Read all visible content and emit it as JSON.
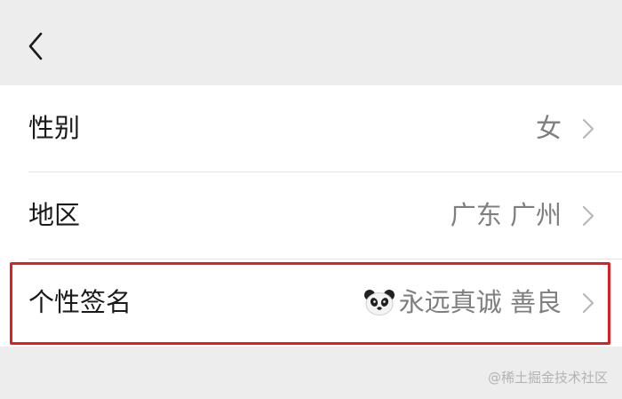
{
  "header": {
    "back_icon": "chevron-left-icon"
  },
  "rows": [
    {
      "label": "性别",
      "value": "女"
    },
    {
      "label": "地区",
      "value": "广东 广州"
    },
    {
      "label": "个性签名",
      "value_emoji": "panda-face-icon",
      "value": "永远真诚 善良"
    }
  ],
  "colors": {
    "background": "#ededed",
    "row_background": "#ffffff",
    "highlight_border": "#e02020",
    "value_text": "#7f7f7f"
  },
  "watermark": "@稀土掘金技术社区"
}
